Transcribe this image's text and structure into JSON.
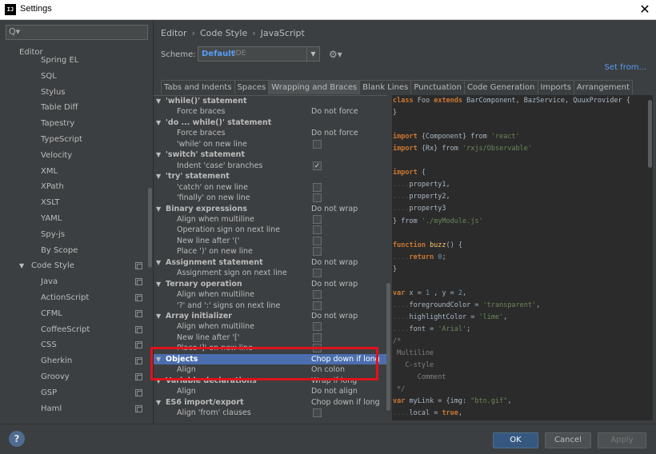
{
  "window": {
    "title": "Settings",
    "app_icon_text": "IJ",
    "close_glyph": "✕"
  },
  "left": {
    "search_icon": "Q▾",
    "section": "Editor",
    "items": [
      {
        "label": "Spring EL",
        "indent": 2,
        "copy": false
      },
      {
        "label": "SQL",
        "indent": 2,
        "copy": false
      },
      {
        "label": "Stylus",
        "indent": 2,
        "copy": false
      },
      {
        "label": "Table Diff",
        "indent": 2,
        "copy": false
      },
      {
        "label": "Tapestry",
        "indent": 2,
        "copy": false
      },
      {
        "label": "TypeScript",
        "indent": 2,
        "copy": false
      },
      {
        "label": "Velocity",
        "indent": 2,
        "copy": false
      },
      {
        "label": "XML",
        "indent": 2,
        "copy": false
      },
      {
        "label": "XPath",
        "indent": 2,
        "copy": false
      },
      {
        "label": "XSLT",
        "indent": 2,
        "copy": false
      },
      {
        "label": "YAML",
        "indent": 2,
        "copy": false
      },
      {
        "label": "Spy-js",
        "indent": 2,
        "copy": false
      },
      {
        "label": "By Scope",
        "indent": 2,
        "copy": false
      },
      {
        "label": "Code Style",
        "indent": 1,
        "copy": true,
        "expanded": true
      },
      {
        "label": "Java",
        "indent": 2,
        "copy": true
      },
      {
        "label": "ActionScript",
        "indent": 2,
        "copy": true
      },
      {
        "label": "CFML",
        "indent": 2,
        "copy": true
      },
      {
        "label": "CoffeeScript",
        "indent": 2,
        "copy": true
      },
      {
        "label": "CSS",
        "indent": 2,
        "copy": true
      },
      {
        "label": "Gherkin",
        "indent": 2,
        "copy": true
      },
      {
        "label": "Groovy",
        "indent": 2,
        "copy": true
      },
      {
        "label": "GSP",
        "indent": 2,
        "copy": true
      },
      {
        "label": "Haml",
        "indent": 2,
        "copy": true
      }
    ]
  },
  "breadcrumb": [
    "Editor",
    "Code Style",
    "JavaScript"
  ],
  "breadcrumb_sep": "›",
  "scheme": {
    "label": "Scheme:",
    "value": "Default",
    "tag": "IDE",
    "dropdown_glyph": "▼",
    "gear_glyph": "⚙▾"
  },
  "set_from": "Set from...",
  "tabs": [
    {
      "label": "Tabs and Indents",
      "active": false
    },
    {
      "label": "Spaces",
      "active": false
    },
    {
      "label": "Wrapping and Braces",
      "active": true
    },
    {
      "label": "Blank Lines",
      "active": false
    },
    {
      "label": "Punctuation",
      "active": false
    },
    {
      "label": "Code Generation",
      "active": false
    },
    {
      "label": "Imports",
      "active": false
    },
    {
      "label": "Arrangement",
      "active": false
    }
  ],
  "options": [
    {
      "label": "'while()' statement",
      "type": "group"
    },
    {
      "label": "Force braces",
      "type": "sub",
      "value": "Do not force"
    },
    {
      "label": "'do ... while()' statement",
      "type": "group"
    },
    {
      "label": "Force braces",
      "type": "sub",
      "value": "Do not force"
    },
    {
      "label": "'while' on new line",
      "type": "sub",
      "check": false
    },
    {
      "label": "'switch' statement",
      "type": "group"
    },
    {
      "label": "Indent 'case' branches",
      "type": "sub",
      "check": true
    },
    {
      "label": "'try' statement",
      "type": "group"
    },
    {
      "label": "'catch' on new line",
      "type": "sub",
      "check": false
    },
    {
      "label": "'finally' on new line",
      "type": "sub",
      "check": false
    },
    {
      "label": "Binary expressions",
      "type": "group",
      "value": "Do not wrap"
    },
    {
      "label": "Align when multiline",
      "type": "sub",
      "check": false
    },
    {
      "label": "Operation sign on next line",
      "type": "sub",
      "check": false
    },
    {
      "label": "New line after '('",
      "type": "sub",
      "check": false
    },
    {
      "label": "Place ')' on new line",
      "type": "sub",
      "check": false
    },
    {
      "label": "Assignment statement",
      "type": "group",
      "value": "Do not wrap"
    },
    {
      "label": "Assignment sign on next line",
      "type": "sub",
      "check": false
    },
    {
      "label": "Ternary operation",
      "type": "group",
      "value": "Do not wrap"
    },
    {
      "label": "Align when multiline",
      "type": "sub",
      "check": false
    },
    {
      "label": "'?' and ':' signs on next line",
      "type": "sub",
      "check": false
    },
    {
      "label": "Array initializer",
      "type": "group",
      "value": "Do not wrap"
    },
    {
      "label": "Align when multiline",
      "type": "sub",
      "check": false
    },
    {
      "label": "New line after '['",
      "type": "sub",
      "check": false
    },
    {
      "label": "Place ']' on new line",
      "type": "sub",
      "check": false
    },
    {
      "label": "Objects",
      "type": "group",
      "value": "Chop down if long",
      "selected": true
    },
    {
      "label": "Align",
      "type": "sub",
      "value": "On colon"
    },
    {
      "label": "Variable declarations",
      "type": "group",
      "value": "Wrap if long"
    },
    {
      "label": "Align",
      "type": "sub",
      "value": "Do not align"
    },
    {
      "label": "ES6 import/export",
      "type": "group",
      "value": "Chop down if long"
    },
    {
      "label": "Align 'from' clauses",
      "type": "sub",
      "check": false
    }
  ],
  "code": [
    [
      [
        "kw",
        "class "
      ],
      [
        "",
        "Foo "
      ],
      [
        "kw",
        "extends "
      ],
      [
        "",
        "BarComponent, BazService, QuuxProvider {"
      ]
    ],
    [
      [
        "",
        "}"
      ]
    ],
    [],
    [
      [
        "kw",
        "import "
      ],
      [
        "",
        "{Component} "
      ],
      [
        "",
        "from "
      ],
      [
        "str",
        "'react'"
      ]
    ],
    [
      [
        "kw",
        "import "
      ],
      [
        "",
        "{Rx} "
      ],
      [
        "",
        "from "
      ],
      [
        "str",
        "'rxjs/Observable'"
      ]
    ],
    [],
    [
      [
        "kw",
        "import "
      ],
      [
        "",
        "{"
      ]
    ],
    [
      [
        "dot",
        "...."
      ],
      [
        "",
        "property1,"
      ]
    ],
    [
      [
        "dot",
        "...."
      ],
      [
        "",
        "property2,"
      ]
    ],
    [
      [
        "dot",
        "...."
      ],
      [
        "",
        "property3"
      ]
    ],
    [
      [
        "",
        "} "
      ],
      [
        "",
        "from "
      ],
      [
        "str",
        "'./myModule.js'"
      ]
    ],
    [],
    [
      [
        "kw",
        "function "
      ],
      [
        "fn",
        "buzz"
      ],
      [
        "",
        "() {"
      ]
    ],
    [
      [
        "dot",
        "...."
      ],
      [
        "kw",
        "return "
      ],
      [
        "num",
        "0"
      ],
      [
        "",
        ";"
      ]
    ],
    [
      [
        "",
        "}"
      ]
    ],
    [],
    [
      [
        "kw",
        "var "
      ],
      [
        "",
        "x = "
      ],
      [
        "num",
        "1"
      ],
      [
        "",
        " , y = "
      ],
      [
        "num",
        "2"
      ],
      [
        "",
        ","
      ]
    ],
    [
      [
        "dot",
        "...."
      ],
      [
        "",
        "foregroundColor = "
      ],
      [
        "str",
        "'transparent'"
      ],
      [
        "",
        ","
      ]
    ],
    [
      [
        "dot",
        "...."
      ],
      [
        "",
        "highlightColor = "
      ],
      [
        "str",
        "'lime'"
      ],
      [
        "",
        ","
      ]
    ],
    [
      [
        "dot",
        "...."
      ],
      [
        "",
        "font = "
      ],
      [
        "str",
        "'Arial'"
      ],
      [
        "",
        ";"
      ]
    ],
    [
      [
        "cmt",
        "/*"
      ]
    ],
    [
      [
        "cmt",
        " Multiline"
      ]
    ],
    [
      [
        "cmt",
        "   C-style"
      ]
    ],
    [
      [
        "cmt",
        "      Comment"
      ]
    ],
    [
      [
        "cmt",
        " */"
      ]
    ],
    [
      [
        "kw",
        "var "
      ],
      [
        "",
        "myLink = {img: "
      ],
      [
        "str",
        "\"btn.gif\""
      ],
      [
        "",
        ","
      ]
    ],
    [
      [
        "dot",
        "...."
      ],
      [
        "",
        "local = "
      ],
      [
        "kw",
        "true"
      ],
      [
        "",
        ","
      ]
    ]
  ],
  "footer": {
    "help": "?",
    "ok": "OK",
    "cancel": "Cancel",
    "apply": "Apply"
  }
}
